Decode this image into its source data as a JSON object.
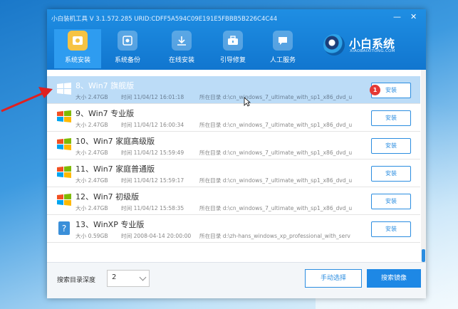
{
  "window": {
    "title": "小白装机工具 V 3.1.572.285 URID:CDFF5A594C09E191E5FBBB5B226C4C44",
    "minimize_label": "—",
    "close_label": "✕"
  },
  "nav": [
    {
      "label": "系统安装",
      "icon": "disc-install-icon",
      "active": true
    },
    {
      "label": "系统备份",
      "icon": "backup-icon",
      "active": false
    },
    {
      "label": "在线安装",
      "icon": "download-icon",
      "active": false
    },
    {
      "label": "引导修复",
      "icon": "toolbox-icon",
      "active": false
    },
    {
      "label": "人工服务",
      "icon": "chat-icon",
      "active": false
    }
  ],
  "logo": {
    "title": "小白系统",
    "url": "XIAOBAIXITONG.COM"
  },
  "list": {
    "items": [
      {
        "name": "8、Win7 旗舰版",
        "size": "大小 2.47GB",
        "time": "时间 11/04/12 16:01:18",
        "path": "所在目录 d:\\cn_windows_7_ultimate_with_sp1_x86_dvd_u",
        "button": "安装",
        "selected": true,
        "badge": "1"
      },
      {
        "name": "9、Win7 专业版",
        "size": "大小 2.47GB",
        "time": "时间 11/04/12 16:00:34",
        "path": "所在目录 d:\\cn_windows_7_ultimate_with_sp1_x86_dvd_u",
        "button": "安装",
        "selected": false
      },
      {
        "name": "10、Win7 家庭高级版",
        "size": "大小 2.47GB",
        "time": "时间 11/04/12 15:59:49",
        "path": "所在目录 d:\\cn_windows_7_ultimate_with_sp1_x86_dvd_u",
        "button": "安装",
        "selected": false
      },
      {
        "name": "11、Win7 家庭普通版",
        "size": "大小 2.47GB",
        "time": "时间 11/04/12 15:59:17",
        "path": "所在目录 d:\\cn_windows_7_ultimate_with_sp1_x86_dvd_u",
        "button": "安装",
        "selected": false
      },
      {
        "name": "12、Win7 初级版",
        "size": "大小 2.47GB",
        "time": "时间 11/04/12 15:58:35",
        "path": "所在目录 d:\\cn_windows_7_ultimate_with_sp1_x86_dvd_u",
        "button": "安装",
        "selected": false
      },
      {
        "name": "13、WinXP 专业版",
        "size": "大小 0.59GB",
        "time": "时间 2008-04-14 20:00:00",
        "path": "所在目录 d:\\zh-hans_windows_xp_professional_with_serv",
        "button": "安装",
        "selected": false,
        "xp": true
      }
    ]
  },
  "footer": {
    "depth_label": "搜索目录深度",
    "depth_value": "2",
    "manual_button": "手动选择",
    "search_button": "搜索镜像"
  },
  "colors": {
    "accent": "#2b8de0",
    "header": "#1f8ee3",
    "selected_row": "#bcdcf7",
    "badge": "#e53935",
    "arrow": "#e02020"
  }
}
